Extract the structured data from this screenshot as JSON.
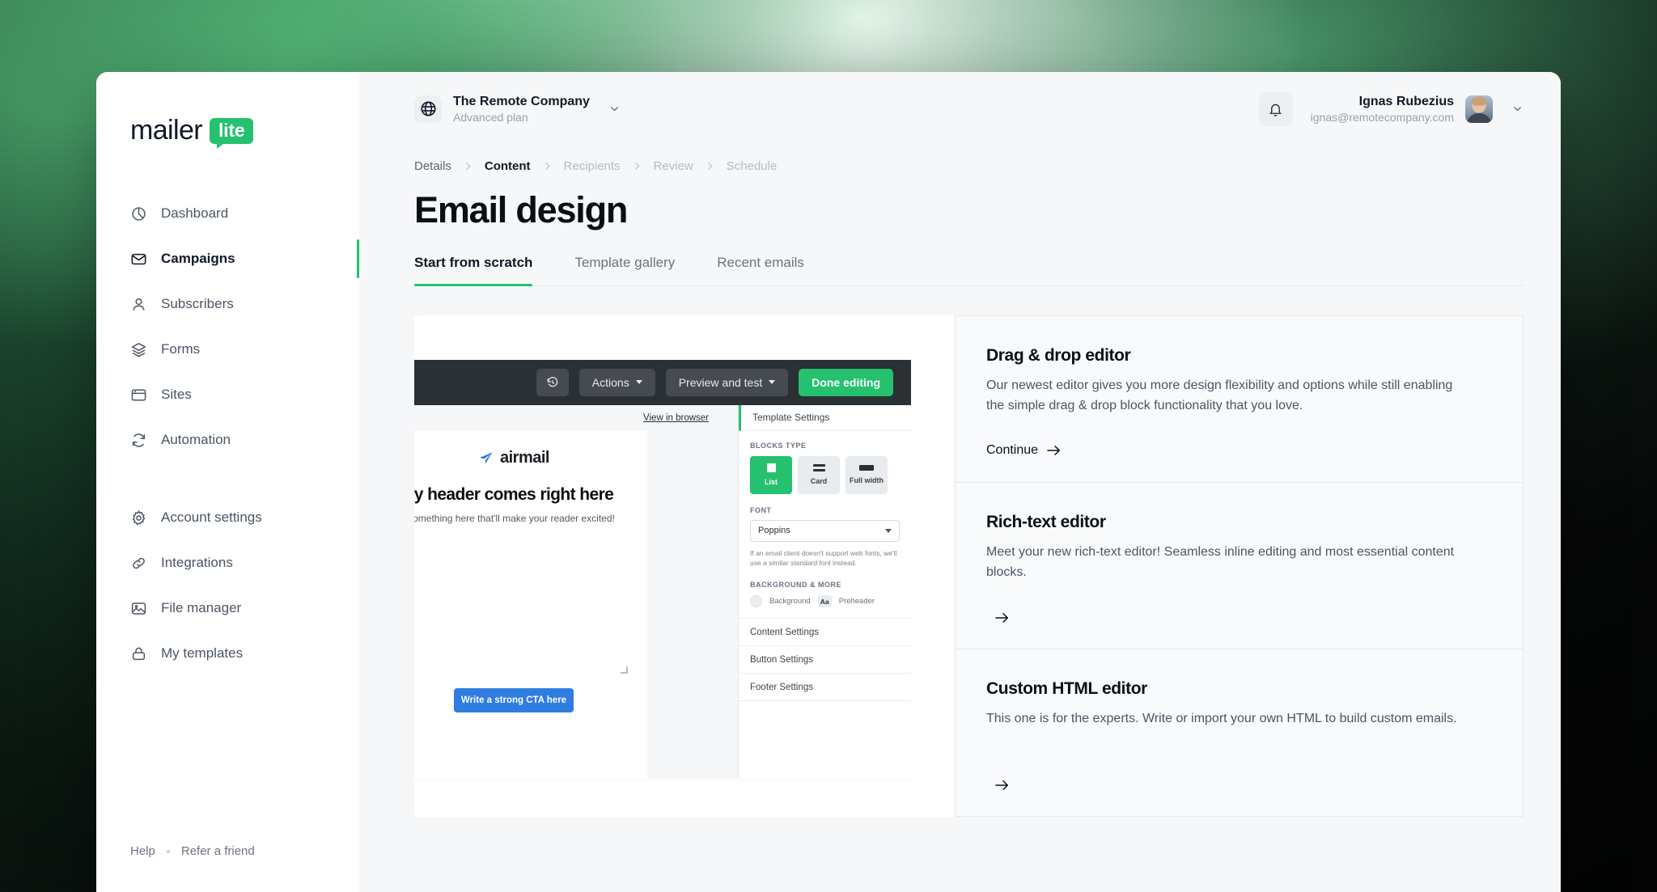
{
  "brand": {
    "accent": "#25c16f",
    "logo_primary": "mailer",
    "logo_badge": "lite"
  },
  "sidebar": {
    "groups": [
      {
        "items": [
          {
            "label": "Dashboard",
            "icon": "pie-chart-icon",
            "active": false
          },
          {
            "label": "Campaigns",
            "icon": "envelope-icon",
            "active": true
          },
          {
            "label": "Subscribers",
            "icon": "user-icon",
            "active": false
          },
          {
            "label": "Forms",
            "icon": "layers-icon",
            "active": false
          },
          {
            "label": "Sites",
            "icon": "browser-icon",
            "active": false
          },
          {
            "label": "Automation",
            "icon": "refresh-icon",
            "active": false
          }
        ]
      },
      {
        "items": [
          {
            "label": "Account settings",
            "icon": "gear-icon",
            "active": false
          },
          {
            "label": "Integrations",
            "icon": "link-icon",
            "active": false
          },
          {
            "label": "File manager",
            "icon": "image-icon",
            "active": false
          },
          {
            "label": "My templates",
            "icon": "lock-icon",
            "active": false
          }
        ]
      }
    ],
    "footer": {
      "help": "Help",
      "refer": "Refer a friend"
    }
  },
  "topbar": {
    "org": {
      "name": "The Remote Company",
      "plan": "Advanced plan",
      "icon": "globe-icon"
    },
    "notifications_icon": "bell-icon",
    "user": {
      "name": "Ignas Rubezius",
      "email": "ignas@remotecompany.com"
    }
  },
  "breadcrumb": [
    {
      "label": "Details",
      "state": "done"
    },
    {
      "label": "Content",
      "state": "active"
    },
    {
      "label": "Recipients",
      "state": "upcoming"
    },
    {
      "label": "Review",
      "state": "upcoming"
    },
    {
      "label": "Schedule",
      "state": "upcoming"
    }
  ],
  "page": {
    "title": "Email design"
  },
  "tabs": [
    {
      "label": "Start from scratch",
      "active": true
    },
    {
      "label": "Template gallery",
      "active": false
    },
    {
      "label": "Recent emails",
      "active": false
    }
  ],
  "preview": {
    "toolbar": {
      "history_icon": "history-icon",
      "actions": "Actions",
      "preview_and_test": "Preview and test",
      "done_editing": "Done editing"
    },
    "canvas": {
      "view_in_browser": "View in browser",
      "logo_wordmark": "airmail",
      "logo_icon": "paper-plane-icon",
      "headline": "y header comes right here",
      "subline": "omething here that'll make your reader excited!",
      "cta_label": "Write a strong CTA here"
    },
    "settings": {
      "title": "Template Settings",
      "blocks_label": "BLOCKS TYPE",
      "blocks": [
        {
          "label": "List",
          "active": true
        },
        {
          "label": "Card",
          "active": false
        },
        {
          "label": "Full width",
          "active": false
        }
      ],
      "font_label": "FONT",
      "font_value": "Poppins",
      "font_hint": "If an email client doesn't support web fonts, we'll use a similar standard font instead.",
      "background_label": "BACKGROUND & MORE",
      "background_option": "Background",
      "preheader_option": "Preheader",
      "preheader_glyph": "Aa",
      "rows": [
        "Content Settings",
        "Button Settings",
        "Footer Settings"
      ]
    }
  },
  "editor_cards": [
    {
      "title": "Drag & drop editor",
      "body": "Our newest editor gives you more design flexibility and options while still enabling the simple drag & drop block functionality that you love.",
      "action": "Continue"
    },
    {
      "title": "Rich-text editor",
      "body": "Meet your new rich-text editor! Seamless inline editing and most essential content blocks.",
      "action": ""
    },
    {
      "title": "Custom HTML editor",
      "body": "This one is for the experts. Write or import your own HTML to build custom emails.",
      "action": ""
    }
  ]
}
